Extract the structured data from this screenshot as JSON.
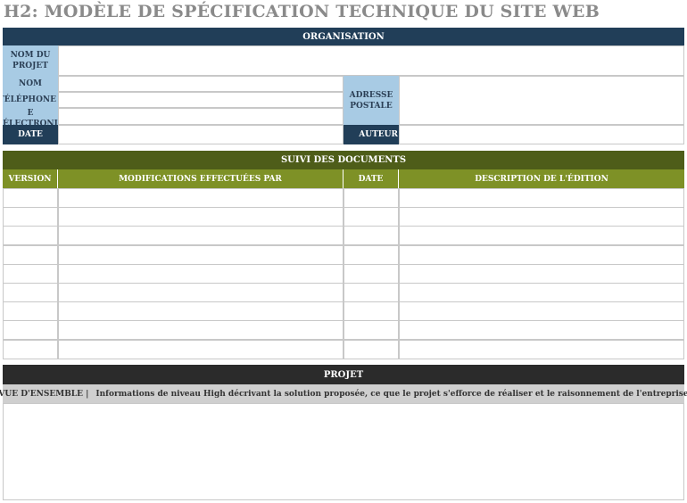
{
  "title": "H2: MODÈLE DE SPÉCIFICATION TECHNIQUE DU SITE WEB",
  "organisation": {
    "header": "ORGANISATION",
    "project_name_label": "NOM DU PROJET",
    "name_label": "NOM",
    "phone_label": "TÉLÉPHONE",
    "email_label": "E ÉLECTRONI",
    "address_label": "ADRESSE POSTALE",
    "date_label": "DATE",
    "author_label": "AUTEUR"
  },
  "tracking": {
    "header": "SUIVI DES DOCUMENTS",
    "columns": [
      "VERSION",
      "MODIFICATIONS EFFECTUÉES PAR",
      "DATE",
      "DESCRIPTION DE L'ÉDITION"
    ],
    "row_count": 9
  },
  "project": {
    "header": "PROJET",
    "overview_label": "VUE D'ENSEMBLE |",
    "overview_text": "Informations de niveau High décrivant la solution proposée, ce que le projet s'efforce de réaliser et le raisonnement de l'entreprise"
  },
  "colors": {
    "navy": "#213e58",
    "light_blue": "#a8cbe4",
    "olive_dark": "#4e5d19",
    "olive": "#7e9126",
    "dark": "#2b2b2b",
    "grey": "#cfcfcf"
  }
}
